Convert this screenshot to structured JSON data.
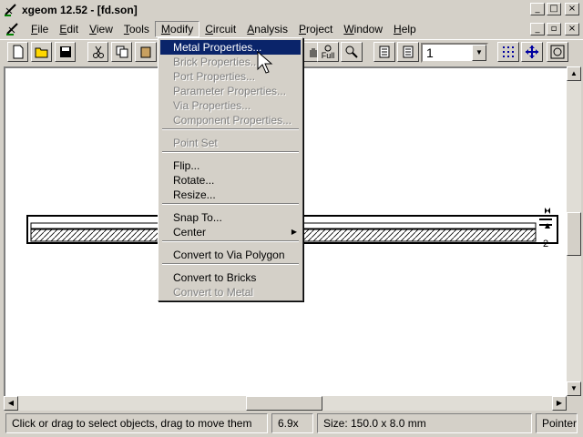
{
  "window": {
    "title": "xgeom 12.52 - [fd.son]"
  },
  "menubar": {
    "items": [
      {
        "label": "File",
        "key": "F",
        "rest": "ile"
      },
      {
        "label": "Edit",
        "key": "E",
        "rest": "dit"
      },
      {
        "label": "View",
        "key": "V",
        "rest": "iew"
      },
      {
        "label": "Tools",
        "key": "T",
        "rest": "ools"
      },
      {
        "label": "Modify",
        "key": "M",
        "rest": "odify"
      },
      {
        "label": "Circuit",
        "key": "C",
        "rest": "ircuit"
      },
      {
        "label": "Analysis",
        "key": "A",
        "rest": "nalysis"
      },
      {
        "label": "Project",
        "key": "P",
        "rest": "roject"
      },
      {
        "label": "Window",
        "key": "W",
        "rest": "indow"
      },
      {
        "label": "Help",
        "key": "H",
        "rest": "elp"
      }
    ]
  },
  "toolbar": {
    "level_value": "1",
    "full_label": "Full"
  },
  "modify_menu": {
    "items": [
      {
        "label": "Metal Properties...",
        "enabled": true,
        "highlighted": true
      },
      {
        "label": "Brick Properties...",
        "enabled": false
      },
      {
        "label": "Port Properties...",
        "enabled": false
      },
      {
        "label": "Parameter Properties...",
        "enabled": false
      },
      {
        "label": "Via Properties...",
        "enabled": false
      },
      {
        "label": "Component Properties...",
        "enabled": false
      },
      {
        "label": "Point Set",
        "enabled": false
      },
      {
        "label": "Flip...",
        "enabled": true
      },
      {
        "label": "Rotate...",
        "enabled": true
      },
      {
        "label": "Resize...",
        "enabled": true
      },
      {
        "label": "Snap To...",
        "enabled": true
      },
      {
        "label": "Center",
        "enabled": true,
        "submenu": true
      },
      {
        "label": "Convert to Via Polygon",
        "enabled": true
      },
      {
        "label": "Convert to Bricks",
        "enabled": true
      },
      {
        "label": "Convert to Metal",
        "enabled": false
      }
    ]
  },
  "canvas": {
    "port_label": "2"
  },
  "statusbar": {
    "hint": "Click or drag to select objects, drag to move them",
    "zoom": "6.9x",
    "size": "Size: 150.0 x 8.0 mm",
    "mode": "Pointer"
  },
  "colors": {
    "highlight": "#0a246a",
    "face": "#d4d0c8"
  }
}
